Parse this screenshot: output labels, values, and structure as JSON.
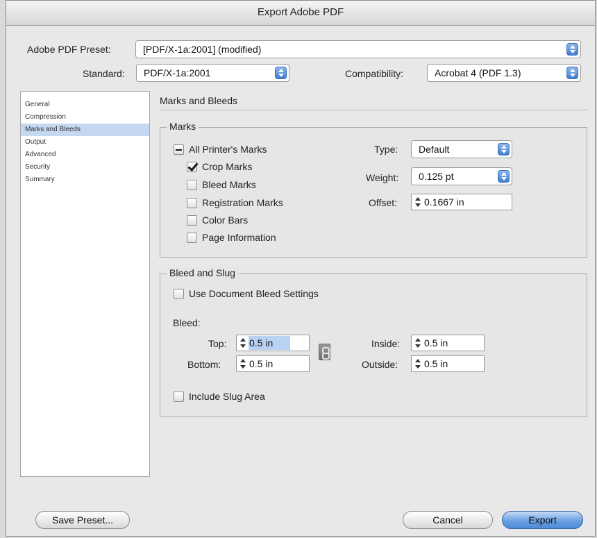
{
  "window": {
    "title": "Export Adobe PDF"
  },
  "preset": {
    "label": "Adobe PDF Preset:",
    "value": "[PDF/X-1a:2001] (modified)"
  },
  "standard": {
    "label": "Standard:",
    "value": "PDF/X-1a:2001"
  },
  "compatibility": {
    "label": "Compatibility:",
    "value": "Acrobat 4 (PDF 1.3)"
  },
  "sidebar": {
    "items": [
      {
        "label": "General",
        "selected": false
      },
      {
        "label": "Compression",
        "selected": false
      },
      {
        "label": "Marks and Bleeds",
        "selected": true
      },
      {
        "label": "Output",
        "selected": false
      },
      {
        "label": "Advanced",
        "selected": false
      },
      {
        "label": "Security",
        "selected": false
      },
      {
        "label": "Summary",
        "selected": false
      }
    ]
  },
  "panel": {
    "title": "Marks and Bleeds"
  },
  "marks": {
    "group_label": "Marks",
    "all_printers_marks": {
      "label": "All Printer's Marks",
      "state": "mixed"
    },
    "crop_marks": {
      "label": "Crop Marks",
      "checked": true
    },
    "bleed_marks": {
      "label": "Bleed Marks",
      "checked": false
    },
    "registration_marks": {
      "label": "Registration Marks",
      "checked": false
    },
    "color_bars": {
      "label": "Color Bars",
      "checked": false
    },
    "page_information": {
      "label": "Page Information",
      "checked": false
    },
    "type": {
      "label": "Type:",
      "value": "Default"
    },
    "weight": {
      "label": "Weight:",
      "value": "0.125 pt"
    },
    "offset": {
      "label": "Offset:",
      "value": "0.1667 in"
    }
  },
  "bleed_slug": {
    "group_label": "Bleed and Slug",
    "use_document_bleed": {
      "label": "Use Document Bleed Settings",
      "checked": false
    },
    "bleed_label": "Bleed:",
    "top": {
      "label": "Top:",
      "value": "0.5 in"
    },
    "bottom": {
      "label": "Bottom:",
      "value": "0.5 in"
    },
    "inside": {
      "label": "Inside:",
      "value": "0.5 in"
    },
    "outside": {
      "label": "Outside:",
      "value": "0.5 in"
    },
    "include_slug": {
      "label": "Include Slug Area",
      "checked": false
    }
  },
  "buttons": {
    "save_preset": "Save Preset...",
    "cancel": "Cancel",
    "export": "Export"
  },
  "colors": {
    "accent": "#4d8bd8",
    "selection": "#c5d8f1"
  },
  "icons": {
    "popup_arrows": "up-down-arrows-icon",
    "stepper": "stepper-icon",
    "chain": "chain-link-icon"
  }
}
